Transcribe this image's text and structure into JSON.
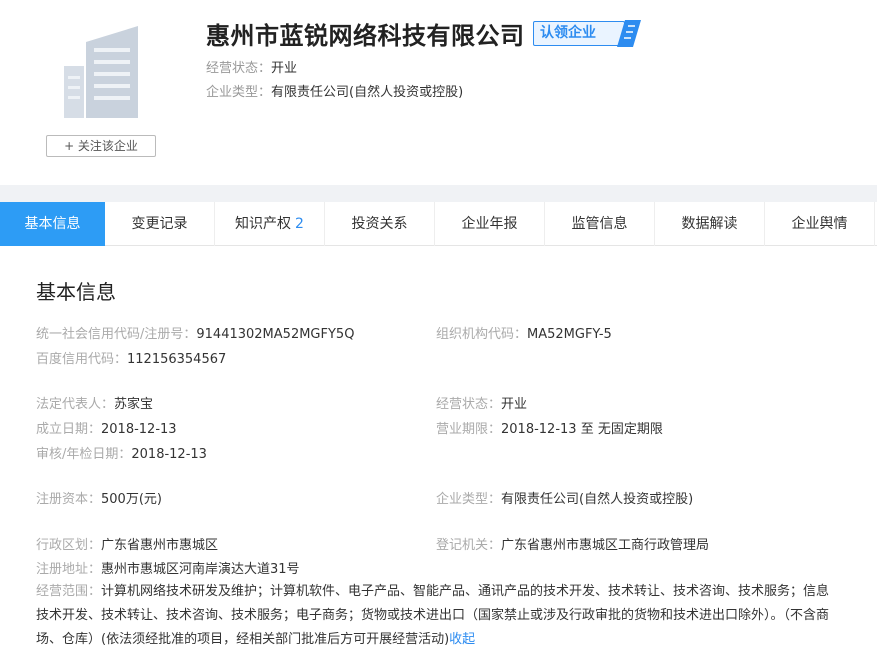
{
  "header": {
    "company_name": "惠州市蓝锐网络科技有限公司",
    "claim_badge": "认领企业",
    "follow_button": "+ 关注该企业",
    "status_label": "经营状态：",
    "status_value": "开业",
    "type_label": "企业类型：",
    "type_value": "有限责任公司(自然人投资或控股)",
    "colors": {
      "accent": "#2d8cf0",
      "active_tab": "#2d9cf5"
    },
    "icons": [
      "building-logo-icon",
      "claim-tag-icon"
    ]
  },
  "tabs": [
    {
      "label": "基本信息",
      "active": true
    },
    {
      "label": "变更记录"
    },
    {
      "label": "知识产权",
      "count": "2"
    },
    {
      "label": "投资关系"
    },
    {
      "label": "企业年报"
    },
    {
      "label": "监管信息"
    },
    {
      "label": "数据解读"
    },
    {
      "label": "企业舆情"
    }
  ],
  "basic": {
    "title": "基本信息",
    "credit_code_label": "统一社会信用代码/注册号：",
    "credit_code": "91441302MA52MGFY5Q",
    "org_code_label": "组织机构代码：",
    "org_code": "MA52MGFY-5",
    "baidu_code_label": "百度信用代码：",
    "baidu_code": "112156354567",
    "legal_rep_label": "法定代表人：",
    "legal_rep": "苏家宝",
    "status_label": "经营状态：",
    "status": "开业",
    "founded_label": "成立日期：",
    "founded": "2018-12-13",
    "term_label": "营业期限：",
    "term": "2018-12-13 至 无固定期限",
    "audit_label": "审核/年检日期：",
    "audit": "2018-12-13",
    "capital_label": "注册资本：",
    "capital": "500万(元)",
    "type_label": "企业类型：",
    "type": "有限责任公司(自然人投资或控股)",
    "region_label": "行政区划：",
    "region": "广东省惠州市惠城区",
    "authority_label": "登记机关：",
    "authority": "广东省惠州市惠城区工商行政管理局",
    "address_label": "注册地址：",
    "address": "惠州市惠城区河南岸演达大道31号",
    "scope_label": "经营范围：",
    "scope": "计算机网络技术研发及维护；计算机软件、电子产品、智能产品、通讯产品的技术开发、技术转让、技术咨询、技术服务；信息技术开发、技术转让、技术咨询、技术服务；电子商务；货物或技术进出口（国家禁止或涉及行政审批的货物和技术进出口除外）。（不含商场、仓库）(依法须经批准的项目，经相关部门批准后方可开展经营活动)",
    "collapse_link": "收起"
  }
}
